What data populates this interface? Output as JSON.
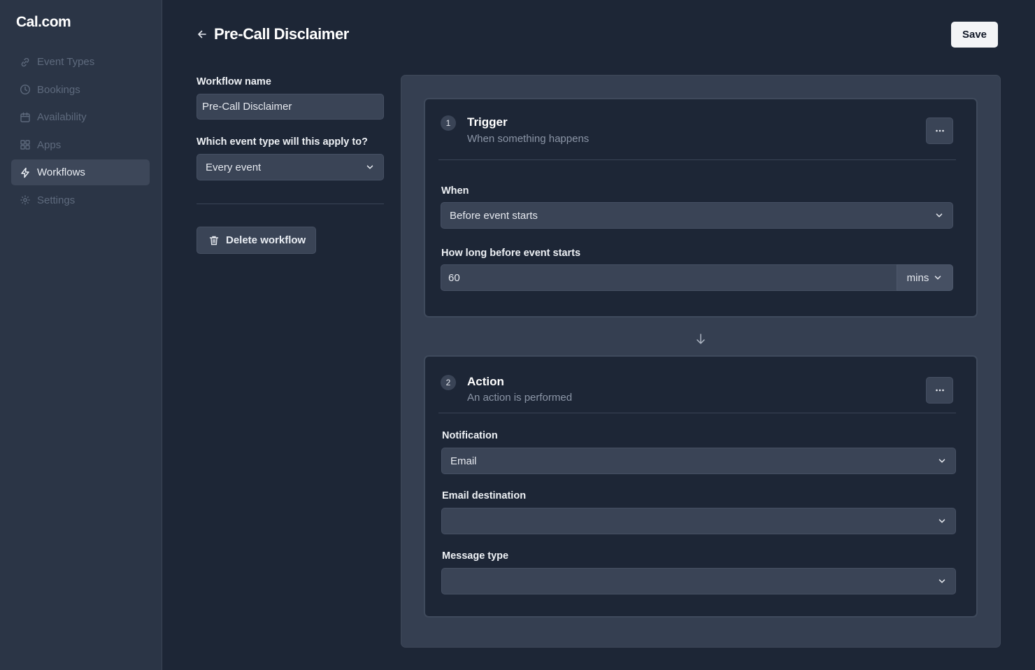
{
  "app": {
    "logo": "Cal.com"
  },
  "sidebar": {
    "items": [
      {
        "label": "Event Types",
        "icon": "link-icon",
        "active": false
      },
      {
        "label": "Bookings",
        "icon": "clock-icon",
        "active": false
      },
      {
        "label": "Availability",
        "icon": "calendar-icon",
        "active": false
      },
      {
        "label": "Apps",
        "icon": "grid-icon",
        "active": false
      },
      {
        "label": "Workflows",
        "icon": "lightning-icon",
        "active": true
      },
      {
        "label": "Settings",
        "icon": "gear-icon",
        "active": false
      }
    ]
  },
  "header": {
    "title": "Pre-Call Disclaimer",
    "save_label": "Save"
  },
  "form": {
    "workflow_name_label": "Workflow name",
    "workflow_name_value": "Pre-Call Disclaimer",
    "event_type_label": "Which event type will this apply to?",
    "event_type_value": "Every event",
    "delete_label": "Delete workflow"
  },
  "trigger": {
    "step": "1",
    "title": "Trigger",
    "subtitle": "When something happens",
    "when_label": "When",
    "when_value": "Before event starts",
    "duration_label": "How long before event starts",
    "duration_value": "60",
    "duration_unit": "mins"
  },
  "action": {
    "step": "2",
    "title": "Action",
    "subtitle": "An action is performed",
    "notification_label": "Notification",
    "notification_value": "Email",
    "email_destination_label": "Email destination",
    "email_destination_value": "",
    "message_type_label": "Message type",
    "message_type_value": ""
  },
  "colors": {
    "background": "#1d2636",
    "sidebar": "#2b3546",
    "panel": "#353f51",
    "input": "#3a4456",
    "save_button": "#f3f4f6"
  }
}
